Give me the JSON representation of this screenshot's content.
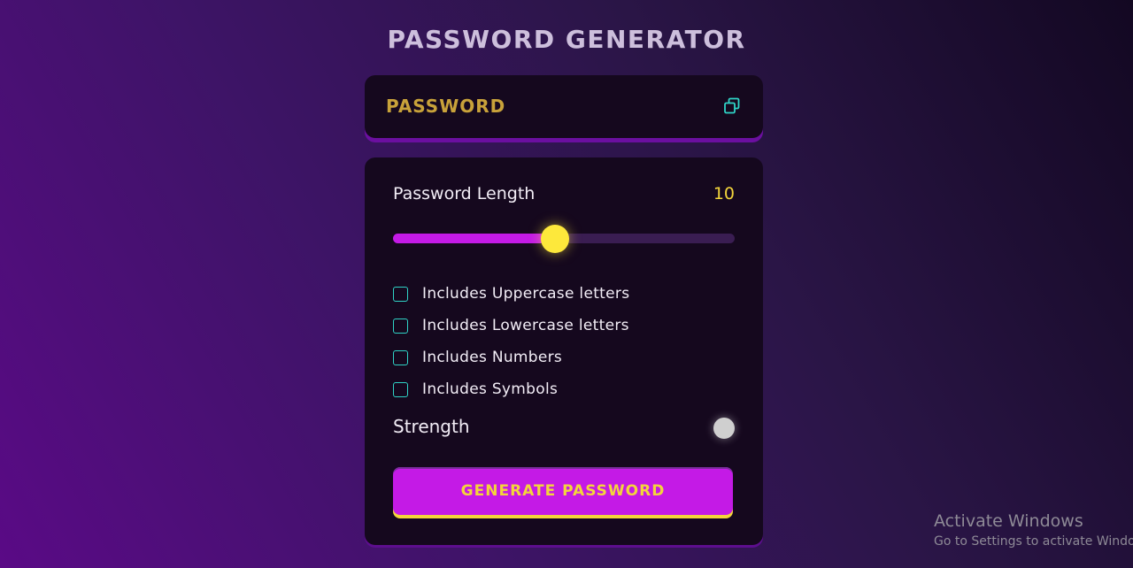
{
  "app": {
    "title": "PASSWORD GENERATOR"
  },
  "password_display": {
    "text": "PASSWORD",
    "copy_icon": "copy-icon"
  },
  "length": {
    "label": "Password Length",
    "value": "10",
    "slider_fraction": 0.474
  },
  "options": [
    {
      "label": "Includes Uppercase letters",
      "checked": false
    },
    {
      "label": "Includes Lowercase letters",
      "checked": false
    },
    {
      "label": "Includes Numbers",
      "checked": false
    },
    {
      "label": "Includes Symbols",
      "checked": false
    }
  ],
  "strength": {
    "label": "Strength",
    "indicator_color": "#cfcfcf"
  },
  "generate_button": {
    "label": "GENERATE PASSWORD"
  },
  "colors": {
    "accent_purple": "#c41ae6",
    "accent_yellow": "#f3d53b",
    "checkbox_teal": "#2fd3c6",
    "card_bg": "#15081e"
  },
  "watermark": {
    "title": "Activate Windows",
    "subtitle": "Go to Settings to activate Windows."
  }
}
